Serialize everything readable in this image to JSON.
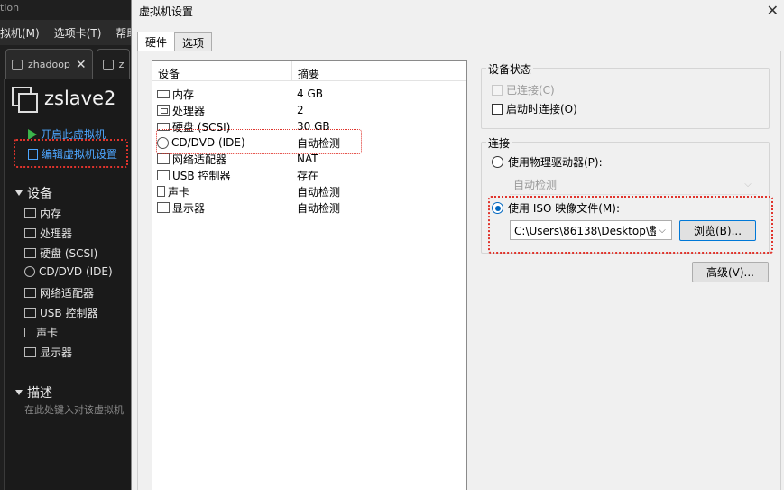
{
  "vm_window": {
    "title_fragment": "tion",
    "menu": [
      "拟机(M)",
      "选项卡(T)",
      "帮助"
    ],
    "tabs": [
      {
        "label": "zhadoop",
        "close": "✕"
      },
      {
        "label": "z"
      }
    ],
    "vm_name": "zslave2",
    "actions": {
      "power_on": "开启此虚拟机",
      "edit_settings": "编辑虚拟机设置"
    },
    "devices_header": "设备",
    "devices": [
      "内存",
      "处理器",
      "硬盘 (SCSI)",
      "CD/DVD (IDE)",
      "网络适配器",
      "USB 控制器",
      "声卡",
      "显示器"
    ],
    "description_header": "描述",
    "description_placeholder": "在此处键入对该虚拟机"
  },
  "dialog": {
    "title": "虚拟机设置",
    "close": "✕",
    "tabs": [
      "硬件",
      "选项"
    ],
    "device_table": {
      "col_device": "设备",
      "col_summary": "摘要",
      "rows": [
        {
          "device": "内存",
          "summary": "4 GB"
        },
        {
          "device": "处理器",
          "summary": "2"
        },
        {
          "device": "硬盘 (SCSI)",
          "summary": "30 GB"
        },
        {
          "device": "CD/DVD (IDE)",
          "summary": "自动检测"
        },
        {
          "device": "网络适配器",
          "summary": "NAT"
        },
        {
          "device": "USB 控制器",
          "summary": "存在"
        },
        {
          "device": "声卡",
          "summary": "自动检测"
        },
        {
          "device": "显示器",
          "summary": "自动检测"
        }
      ]
    },
    "device_status": {
      "label": "设备状态",
      "connected": "已连接(C)",
      "connect_at_power_on": "启动时连接(O)"
    },
    "connection": {
      "label": "连接",
      "use_physical": "使用物理驱动器(P):",
      "physical_value": "自动检测",
      "use_iso": "使用 ISO 映像文件(M):",
      "iso_path": "C:\\Users\\86138\\Desktop\\整",
      "browse": "浏览(B)..."
    },
    "advanced": "高级(V)...",
    "colors": {
      "accent": "#0067c0",
      "highlight": "#e0342c"
    }
  }
}
